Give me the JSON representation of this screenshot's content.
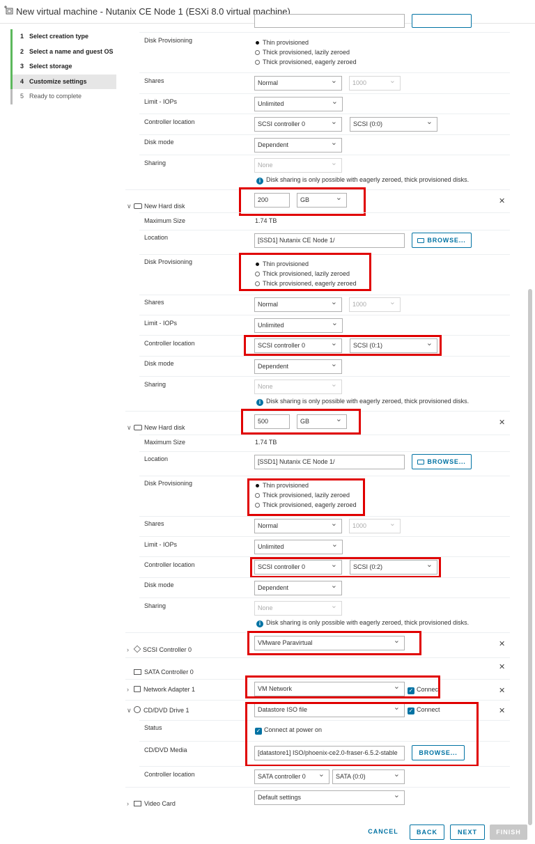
{
  "window": {
    "title": "New virtual machine - Nutanix CE Node 1 (ESXi 8.0 virtual machine)"
  },
  "steps": [
    {
      "num": "1",
      "label": "Select creation type"
    },
    {
      "num": "2",
      "label": "Select a name and guest OS"
    },
    {
      "num": "3",
      "label": "Select storage"
    },
    {
      "num": "4",
      "label": "Customize settings"
    },
    {
      "num": "5",
      "label": "Ready to complete"
    }
  ],
  "labels": {
    "disk_provisioning": "Disk Provisioning",
    "shares": "Shares",
    "limit_iops": "Limit - IOPs",
    "controller_location": "Controller location",
    "disk_mode": "Disk mode",
    "sharing": "Sharing",
    "new_hard_disk": "New Hard disk",
    "maximum_size": "Maximum Size",
    "location": "Location",
    "status": "Status",
    "cd_media": "CD/DVD Media"
  },
  "options": {
    "thin": "Thin provisioned",
    "thick_lazy": "Thick provisioned, lazily zeroed",
    "thick_eager": "Thick provisioned, eagerly zeroed"
  },
  "values": {
    "shares": "Normal",
    "shares_num": "1000",
    "limit": "Unlimited",
    "controller": "SCSI controller 0",
    "disk_mode": "Dependent",
    "sharing": "None",
    "sharing_info": "Disk sharing is only possible with eagerly zeroed, thick provisioned disks.",
    "max_size": "1.74 TB",
    "location": "[SSD1] Nutanix CE Node 1/",
    "unit": "GB",
    "browse": "BROWSE..."
  },
  "disks": [
    {
      "scsi": "SCSI (0:0)"
    },
    {
      "size": "200",
      "scsi": "SCSI (0:1)"
    },
    {
      "size": "500",
      "scsi": "SCSI (0:2)"
    }
  ],
  "devices": {
    "scsi_controller": {
      "label": "SCSI Controller 0",
      "value": "VMware Paravirtual"
    },
    "sata_controller": {
      "label": "SATA Controller 0"
    },
    "network": {
      "label": "Network Adapter 1",
      "value": "VM Network",
      "connect": "Connect"
    },
    "cd": {
      "label": "CD/DVD Drive 1",
      "value": "Datastore ISO file",
      "connect": "Connect",
      "status": "Connect at power on",
      "media": "[datastore1] ISO/phoenix-ce2.0-fraser-6.5.2-stable",
      "controller": "SATA controller 0",
      "slot": "SATA (0:0)"
    },
    "video": {
      "label": "Video Card",
      "value": "Default settings"
    }
  },
  "footer": {
    "cancel": "CANCEL",
    "back": "BACK",
    "next": "NEXT",
    "finish": "FINISH"
  },
  "colors": {
    "accent": "#0072a3",
    "highlight": "#e00000",
    "step_done": "#5cb85c"
  }
}
